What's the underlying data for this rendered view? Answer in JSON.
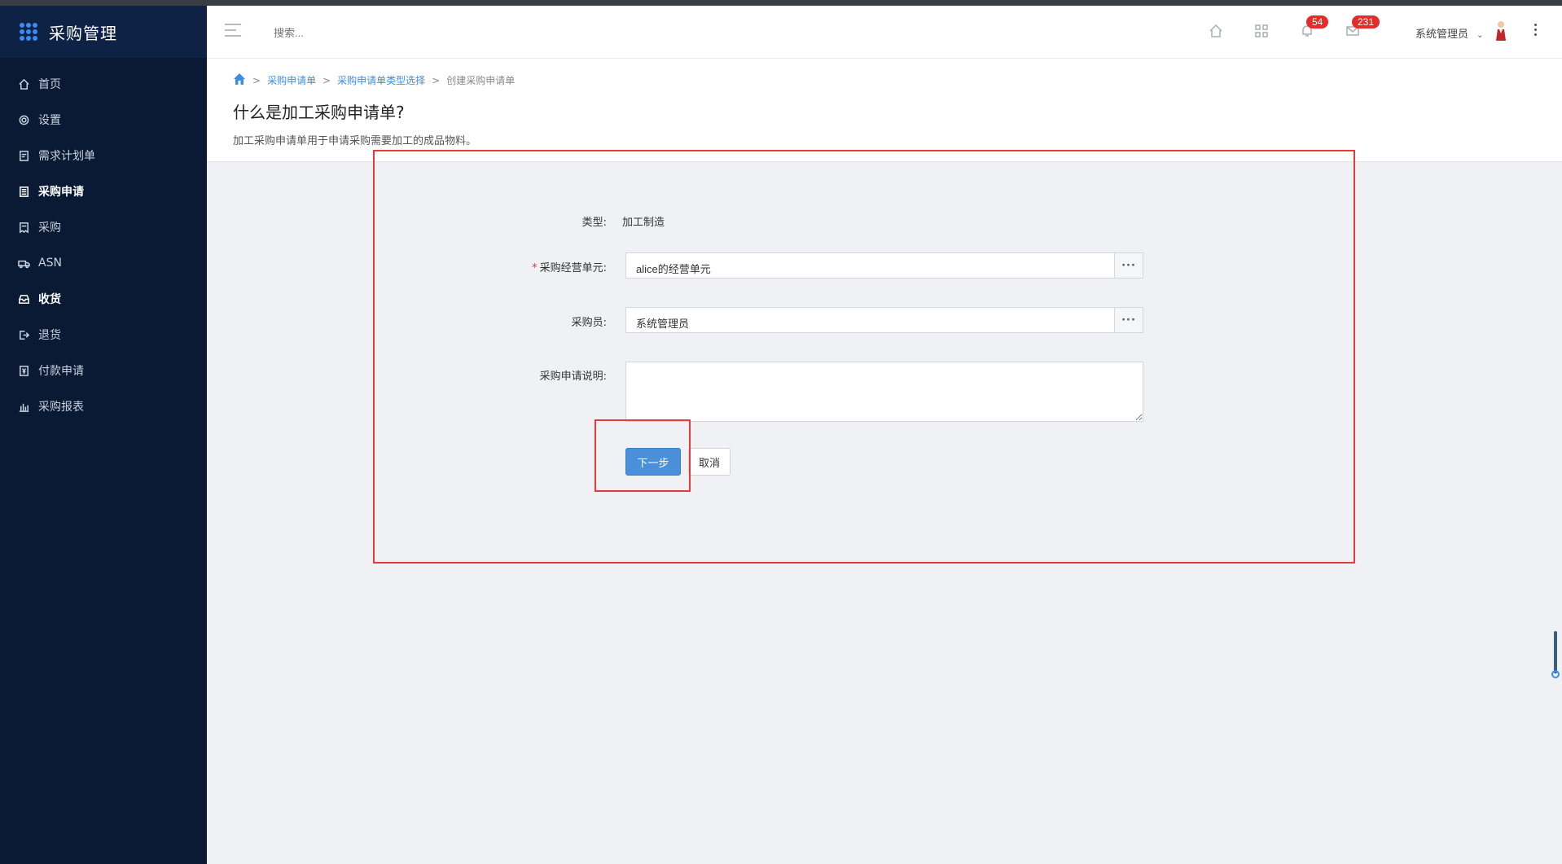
{
  "app": {
    "title": "采购管理"
  },
  "sidebar": {
    "items": [
      {
        "label": "首页",
        "icon": "home-icon",
        "active": false
      },
      {
        "label": "设置",
        "icon": "gear-icon",
        "active": false
      },
      {
        "label": "需求计划单",
        "icon": "document-icon",
        "active": false
      },
      {
        "label": "采购申请",
        "icon": "form-icon",
        "active": true
      },
      {
        "label": "采购",
        "icon": "receipt-icon",
        "active": false
      },
      {
        "label": "ASN",
        "icon": "truck-icon",
        "active": false
      },
      {
        "label": "收货",
        "icon": "inbox-icon",
        "active": true
      },
      {
        "label": "退货",
        "icon": "exit-icon",
        "active": false
      },
      {
        "label": "付款申请",
        "icon": "payment-icon",
        "active": false
      },
      {
        "label": "采购报表",
        "icon": "bar-chart-icon",
        "active": false
      }
    ]
  },
  "header": {
    "search_placeholder": "搜索...",
    "notifications_count": "54",
    "messages_count": "231",
    "user_name": "系统管理员"
  },
  "breadcrumb": {
    "items": [
      "采购申请单",
      "采购申请单类型选择"
    ],
    "current": "创建采购申请单",
    "separator": ">"
  },
  "page": {
    "title": "什么是加工采购申请单?",
    "description": "加工采购申请单用于申请采购需要加工的成品物料。"
  },
  "form": {
    "type_label": "类型:",
    "type_value": "加工制造",
    "unit_label": "采购经营单元:",
    "unit_value": "alice的经营单元",
    "buyer_label": "采购员:",
    "buyer_value": "系统管理员",
    "note_label": "采购申请说明:",
    "note_value": "",
    "picker_button": "···",
    "required_mark": "*",
    "next_button": "下一步",
    "cancel_button": "取消"
  },
  "colors": {
    "sidebar_bg": "#0b1a34",
    "accent": "#4a8fd9",
    "badge": "#e62b2b",
    "highlight_box": "#e53b3b"
  }
}
